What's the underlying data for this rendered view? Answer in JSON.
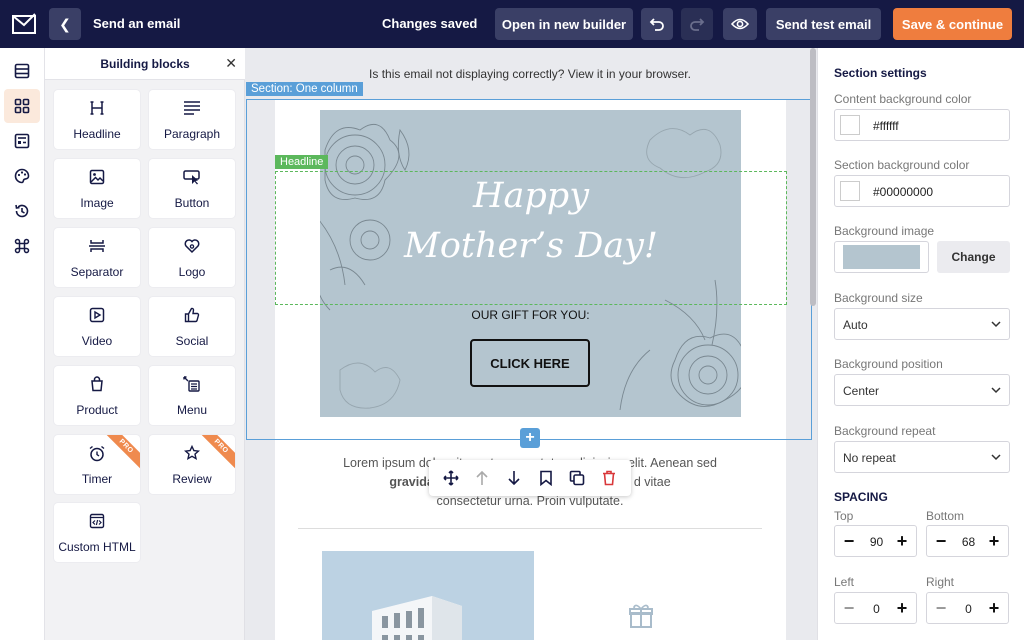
{
  "topbar": {
    "title": "Send an email",
    "status": "Changes saved",
    "open_builder_label": "Open in new builder",
    "send_test_label": "Send test email",
    "save_continue_label": "Save & continue"
  },
  "rail": {
    "items": [
      {
        "icon": "layout-icon",
        "active": false
      },
      {
        "icon": "blocks-grid-icon",
        "active": true
      },
      {
        "icon": "templates-icon",
        "active": false
      },
      {
        "icon": "palette-icon",
        "active": false
      },
      {
        "icon": "history-icon",
        "active": false
      },
      {
        "icon": "command-icon",
        "active": false
      }
    ]
  },
  "blocks": {
    "title": "Building blocks",
    "items": [
      {
        "label": "Headline",
        "icon": "headline-icon",
        "pro": false
      },
      {
        "label": "Paragraph",
        "icon": "paragraph-icon",
        "pro": false
      },
      {
        "label": "Image",
        "icon": "image-icon",
        "pro": false
      },
      {
        "label": "Button",
        "icon": "button-icon",
        "pro": false
      },
      {
        "label": "Separator",
        "icon": "separator-icon",
        "pro": false
      },
      {
        "label": "Logo",
        "icon": "logo-icon",
        "pro": false
      },
      {
        "label": "Video",
        "icon": "video-icon",
        "pro": false
      },
      {
        "label": "Social",
        "icon": "social-icon",
        "pro": false
      },
      {
        "label": "Product",
        "icon": "product-icon",
        "pro": false
      },
      {
        "label": "Menu",
        "icon": "menu-icon",
        "pro": false
      },
      {
        "label": "Timer",
        "icon": "timer-icon",
        "pro": true
      },
      {
        "label": "Review",
        "icon": "review-icon",
        "pro": true
      },
      {
        "label": "Custom HTML",
        "icon": "custom-html-icon",
        "pro": false
      }
    ],
    "pro_label": "PRO"
  },
  "canvas": {
    "notice": "Is this email not displaying correctly? View it in your browser.",
    "section_tag": "Section: One column",
    "headline_tag": "Headline",
    "hero_line1": "Happy",
    "hero_line2": "Mother’s Day!",
    "gift_text": "OUR GIFT FOR YOU:",
    "cta_label": "CLICK HERE",
    "lorem_line1": "Lorem ipsum dolor sit amet, consectetur adipiscing elit. Aenean sed",
    "lorem_line2_bold": "gravida",
    "lorem_line2_rest": "d vitae",
    "lorem_line3": "consectetur urna. Proin vulputate.",
    "hero_bg_color": "#b4c5cf",
    "section_color": "#5a9fd8",
    "headline_color": "#5cb85c"
  },
  "settings": {
    "title": "Section settings",
    "content_bg_label": "Content background color",
    "content_bg_value": "#ffffff",
    "section_bg_label": "Section background color",
    "section_bg_value": "#00000000",
    "bg_image_label": "Background image",
    "change_label": "Change",
    "bg_size_label": "Background size",
    "bg_size_value": "Auto",
    "bg_position_label": "Background position",
    "bg_position_value": "Center",
    "bg_repeat_label": "Background repeat",
    "bg_repeat_value": "No repeat",
    "spacing_title": "SPACING",
    "top_label": "Top",
    "top_value": "90",
    "bottom_label": "Bottom",
    "bottom_value": "68",
    "left_label": "Left",
    "left_value": "0",
    "right_label": "Right",
    "right_value": "0"
  },
  "colors": {
    "topbar": "#151944",
    "accent": "#ef7d3e",
    "toolbar_button": "#3a3f66"
  }
}
